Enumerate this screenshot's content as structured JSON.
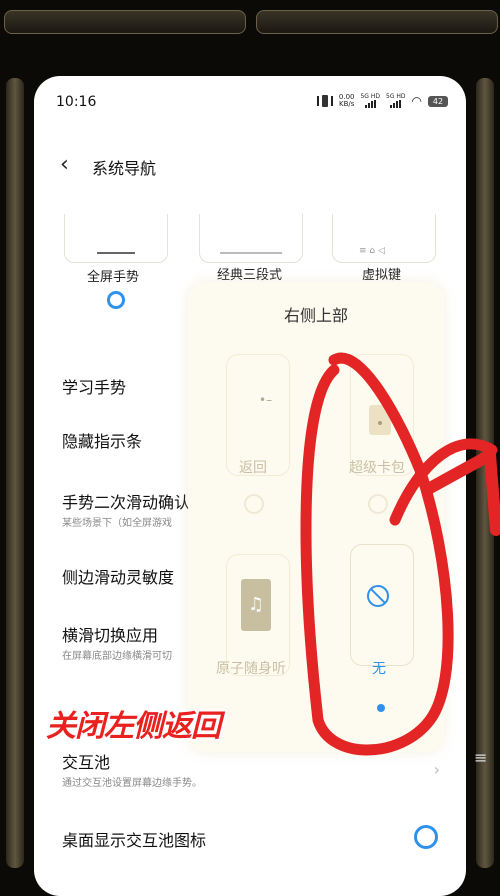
{
  "status_bar": {
    "time": "10:16",
    "speed_value": "0.00",
    "speed_unit": "KB/s",
    "sim1": "5G HD",
    "sim2": "5G HD",
    "battery": "42"
  },
  "header": {
    "title": "系统导航"
  },
  "nav_styles": {
    "options": [
      {
        "label": "全屏手势",
        "selected": true
      },
      {
        "label": "经典三段式",
        "selected": false
      },
      {
        "label": "虚拟键",
        "selected": false
      }
    ]
  },
  "settings": {
    "rows": [
      {
        "title": "学习手势"
      },
      {
        "title": "隐藏指示条"
      },
      {
        "title": "手势二次滑动确认",
        "subtitle": "某些场景下（如全屏游戏"
      },
      {
        "title": "侧边滑动灵敏度"
      },
      {
        "title": "横滑切换应用",
        "subtitle": "在屏幕底部边缘横滑可切"
      },
      {
        "title": "交互池",
        "subtitle": "通过交互池设置屏幕边缘手势。"
      },
      {
        "title": "桌面显示交互池图标"
      }
    ]
  },
  "popup": {
    "title": "右侧上部",
    "options": [
      {
        "label": "返回",
        "icon": "back-arrow-icon",
        "selected": false
      },
      {
        "label": "超级卡包",
        "icon": "card-icon",
        "selected": false
      },
      {
        "label": "原子随身听",
        "icon": "music-note-icon",
        "selected": false
      },
      {
        "label": "无",
        "icon": "prohibited-icon",
        "selected": true
      }
    ]
  },
  "annotation": {
    "text": "关闭左侧返回",
    "color": "#e9211f"
  },
  "colors": {
    "accent": "#2f91e9",
    "scribble": "#e32525",
    "frame": "#5e5540"
  }
}
